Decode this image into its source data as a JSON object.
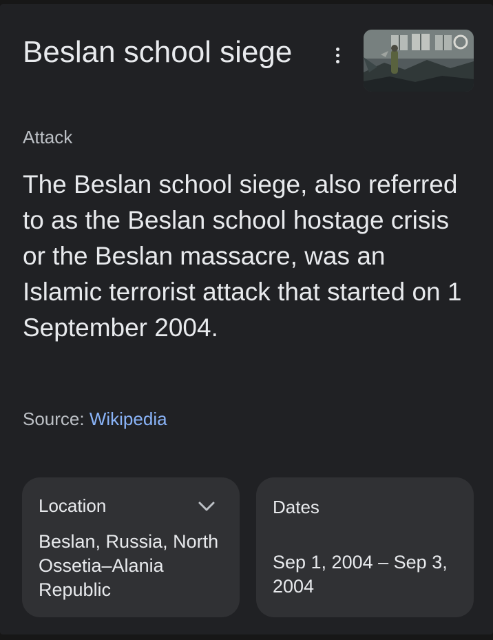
{
  "panel": {
    "title": "Beslan school siege",
    "subtitle": "Attack",
    "description": "The Beslan school siege, also referred to as the Beslan school hostage crisis or the Beslan massacre, was an Islamic terrorist attack that started on 1 September 2004.",
    "source_label": "Source:",
    "source_link": "Wikipedia",
    "more_icon": "more-vert-icon",
    "thumbnail_icon": "photo-thumbnail"
  },
  "info_cards": {
    "location": {
      "label": "Location",
      "value": "Beslan, Russia, North Ossetia–Alania Republic",
      "icon": "chevron-down-icon"
    },
    "dates": {
      "label": "Dates",
      "value": "Sep 1, 2004 – Sep 3, 2004"
    }
  },
  "colors": {
    "background": "#202124",
    "card": "#303134",
    "text": "#e8eaed",
    "secondary_text": "#bdc1c6",
    "link": "#8ab4f8"
  }
}
